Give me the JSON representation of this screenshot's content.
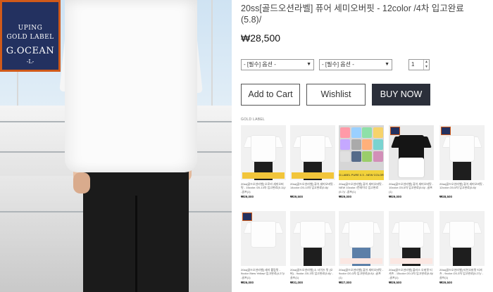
{
  "label_patch": {
    "line1": "UPING",
    "line2": "GOLD LABEL",
    "line3": "G.OCEAN",
    "line4": "-L-"
  },
  "product": {
    "title": "20ss[골드오션라벨] 퓨어 세미오버핏 - 12color /4차 입고완료(5.8)/",
    "price": "₩28,500",
    "option1": "- [필수] 옵션 -",
    "option2": "- [필수] 옵션 -",
    "quantity": "1"
  },
  "buttons": {
    "add_to_cart": "Add to Cart",
    "wishlist": "Wishlist",
    "buy_now": "BUY NOW"
  },
  "section_label": "GOLD LABEL",
  "colors": {
    "buy_button": "#2b2f3a",
    "patch_navy": "#233160",
    "patch_orange": "#d05a1a",
    "banner_yellow": "#f2d23a"
  },
  "grid": [
    {
      "desc": "20ss[골드오션라벨] 오로라 세미오버핏 - 15color /20-13차 입고완료(5.11)/ -골프(1)",
      "price": "₩29,000",
      "variant": "model-bag"
    },
    {
      "desc": "20ss[골드오션라벨] 퓨어 세미오버핏 - 14color /20-13차 입고완료(5.8)/",
      "price": "₩29,500",
      "variant": "model-bag"
    },
    {
      "desc": "20ss[골드오션라벨] 퓨어 세미오버핏 - NEW 10color /컨테이너 입고완료(5.7)/ -골프(1)",
      "price": "₩29,000",
      "variant": "colors"
    },
    {
      "desc": "20ss[골드오션라벨] 퓨어 세미오버핏 - 10color /20-5차 입고완료(5.6)/ -골프(1)",
      "price": "₩29,000",
      "variant": "black"
    },
    {
      "desc": "20ss[골드오션라벨] 퓨어 세미오버핏 - 12color /20-5차 입고완료(5.8)/",
      "price": "₩28,500",
      "variant": "model-tag"
    },
    {
      "desc": "20ss[골드오션라벨] 세미 롤링핏 - 9color /New Yellow/ 입고완료(4.27)/ -골프(1)",
      "price": "₩26,000",
      "variant": "flat"
    },
    {
      "desc": "20ss[골드오션라벨] 소 사이즈 핏 (오버) - 9color /20-3차 입고완료(5.8)/ -골프(1)",
      "price": "₩31,000",
      "variant": "model"
    },
    {
      "desc": "20ss[골드오션라벨] 퓨어 세미오버핏 - 9color /20-3차 입고완료(5.8)/ -골프(1)",
      "price": "₩27,000",
      "variant": "model-pink"
    },
    {
      "desc": "20ss[골드오션라벨] 플러스 오버핏 티셔츠 - 15color /20-3차 입고완료(5.8)/ -골프(1)",
      "price": "₩29,500",
      "variant": "model-pink"
    },
    {
      "desc": "20ss[골드오션라벨] 티친오버핏 티셔츠 - 9color /20-3차 입고완료(5.27)/ -골프(1)",
      "price": "₩29,500",
      "variant": "model"
    }
  ],
  "thumb_banners": {
    "yellow_text": "G.LABEL PURE 0.3 - NEW COLOR"
  }
}
